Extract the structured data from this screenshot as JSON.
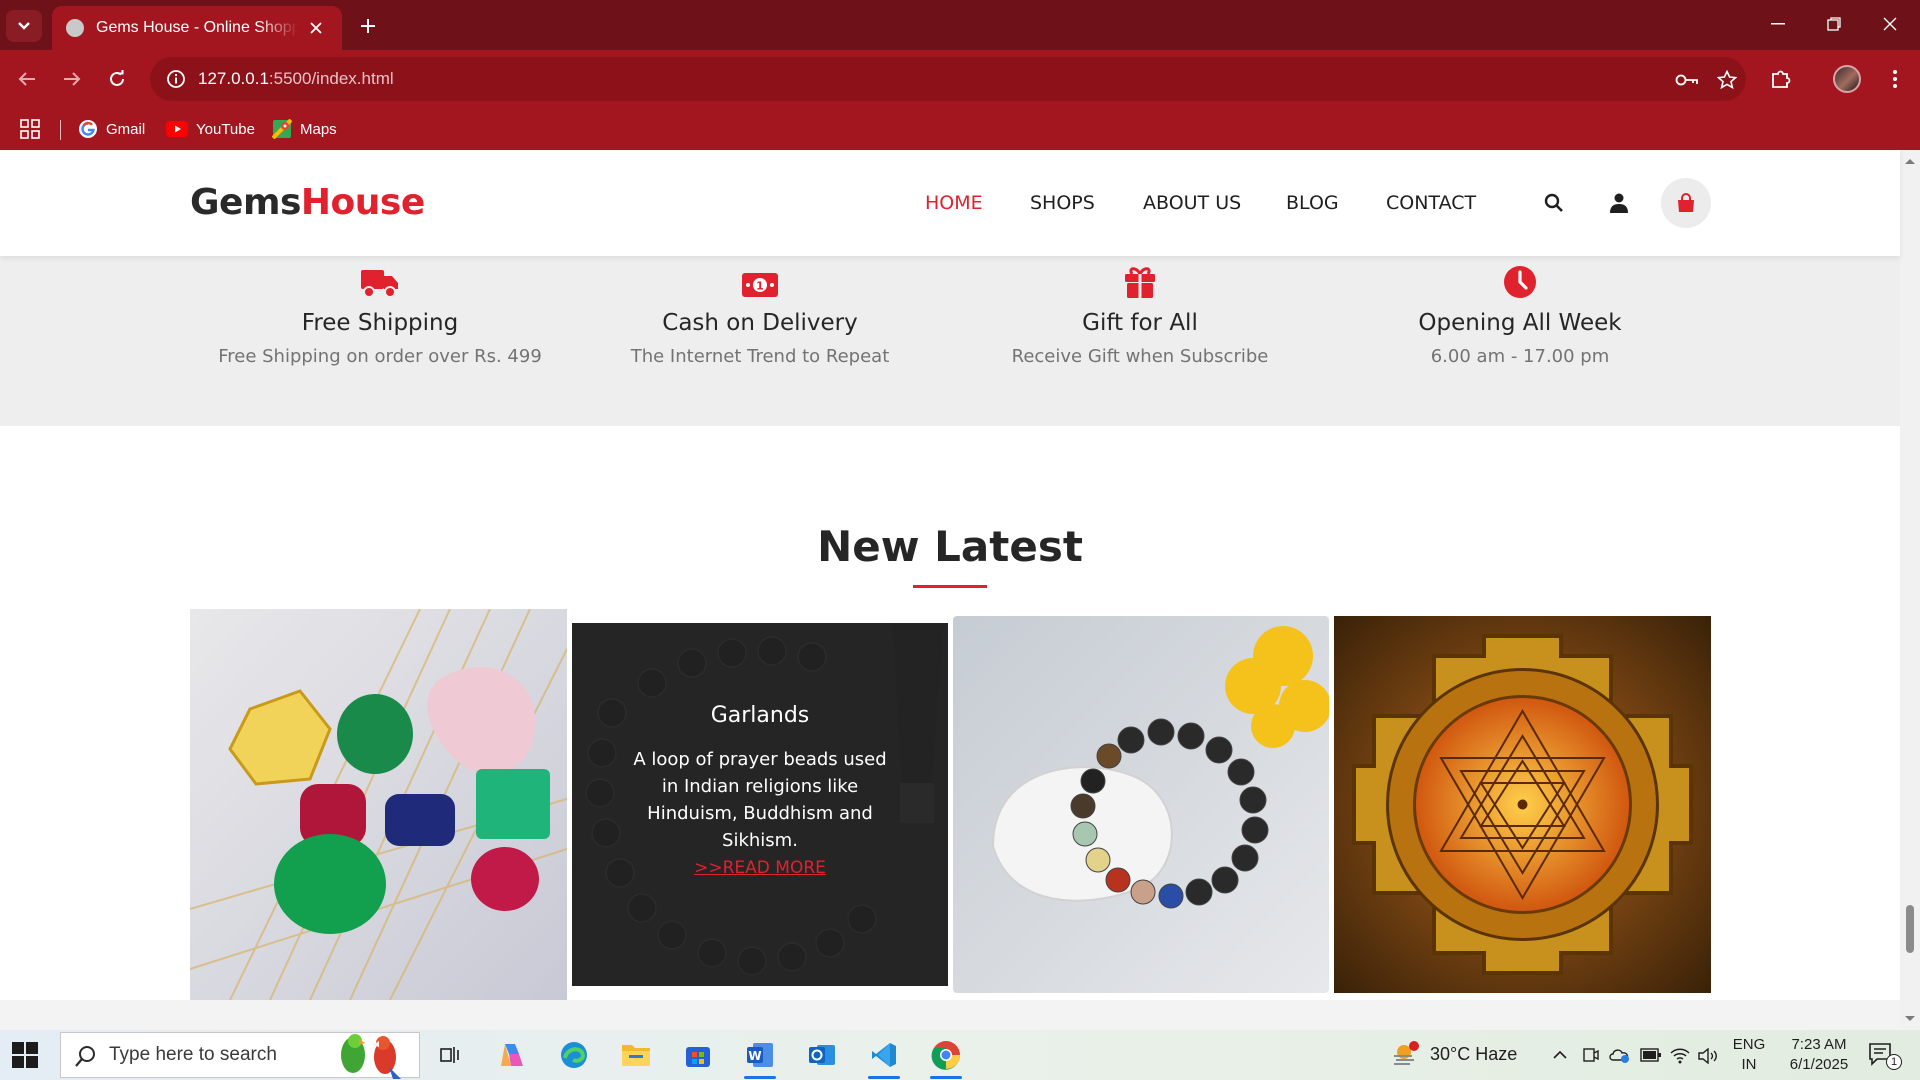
{
  "browser": {
    "tab_title": "Gems House - Online Shopping",
    "url_host": "127.0.0.1",
    "url_path": ":5500/index.html",
    "bookmarks": [
      "Gmail",
      "YouTube",
      "Maps"
    ]
  },
  "site": {
    "logo_part1": "Gems",
    "logo_part2": "House",
    "nav": [
      "HOME",
      "SHOPS",
      "ABOUT US",
      "BLOG",
      "CONTACT"
    ],
    "active_nav": "HOME",
    "accent_color": "#e0212e"
  },
  "features": [
    {
      "icon": "truck-icon",
      "title": "Free Shipping",
      "subtitle": "Free Shipping on order over Rs. 499"
    },
    {
      "icon": "money-icon",
      "title": "Cash on Delivery",
      "subtitle": "The Internet Trend to Repeat"
    },
    {
      "icon": "gift-icon",
      "title": "Gift for All",
      "subtitle": "Receive Gift when Subscribe"
    },
    {
      "icon": "clock-icon",
      "title": "Opening All Week",
      "subtitle": "6.00 am - 17.00 pm"
    }
  ],
  "latest": {
    "heading": "New Latest",
    "cards": [
      {
        "image": "gemstones"
      },
      {
        "image": "prayer-beads",
        "title": "Garlands",
        "description": "A loop of prayer beads used in Indian religions like Hinduism, Buddhism and Sikhism.",
        "link": ">>READ MORE"
      },
      {
        "image": "bracelet"
      },
      {
        "image": "shri-yantra"
      }
    ]
  },
  "taskbar": {
    "search_placeholder": "Type here to search",
    "weather": "30°C  Haze",
    "language_line1": "ENG",
    "language_line2": "IN",
    "time": "7:23 AM",
    "date": "6/1/2025",
    "notification_count": "1"
  }
}
